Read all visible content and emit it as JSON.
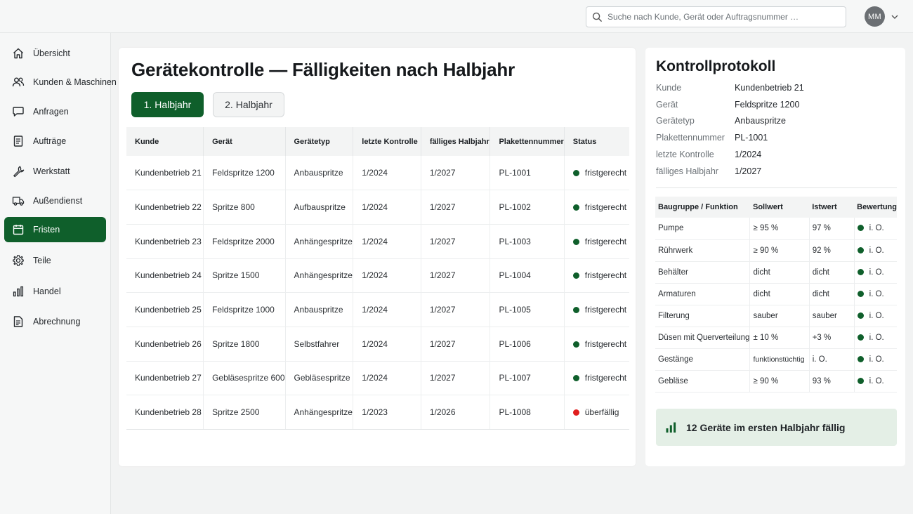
{
  "search": {
    "placeholder": "Suche nach Kunde, Gerät oder Auftragsnummer …",
    "icon": "search-icon"
  },
  "user": {
    "initials": "MM"
  },
  "sidebar": {
    "items": [
      {
        "label": "Übersicht",
        "icon": "home-icon"
      },
      {
        "label": "Kunden & Maschinen",
        "icon": "users-icon"
      },
      {
        "label": "Anfragen",
        "icon": "chat-icon"
      },
      {
        "label": "Aufträge",
        "icon": "document-icon"
      },
      {
        "label": "Werkstatt",
        "icon": "wrench-icon"
      },
      {
        "label": "Außendienst",
        "icon": "truck-icon"
      },
      {
        "label": "Fristen",
        "icon": "calendar-icon",
        "active": true
      },
      {
        "label": "Teile",
        "icon": "gear-icon"
      },
      {
        "label": "Handel",
        "icon": "bar-chart-icon"
      },
      {
        "label": "Abrechnung",
        "icon": "invoice-icon"
      }
    ]
  },
  "main": {
    "title": "Gerätekontrolle — Fälligkeiten nach Halbjahr",
    "tabs": [
      {
        "label": "1. Halbjahr",
        "active": true
      },
      {
        "label": "2. Halbjahr",
        "active": false
      }
    ],
    "columns": [
      "Kunde",
      "Gerät",
      "Gerätetyp",
      "letzte Kontrolle",
      "fälliges Halbjahr",
      "Plakettennummer",
      "Status"
    ],
    "rows": [
      [
        "Kundenbetrieb 21",
        "Feldspritze 1200",
        "Anbauspritze",
        "1/2024",
        "1/2027",
        "PL-1001",
        "fristgerecht"
      ],
      [
        "Kundenbetrieb 22",
        "Spritze 800",
        "Aufbauspritze",
        "1/2024",
        "1/2027",
        "PL-1002",
        "fristgerecht"
      ],
      [
        "Kundenbetrieb 23",
        "Feldspritze 2000",
        "Anhängespritze",
        "1/2024",
        "1/2027",
        "PL-1003",
        "fristgerecht"
      ],
      [
        "Kundenbetrieb 24",
        "Spritze 1500",
        "Anhängespritze",
        "1/2024",
        "1/2027",
        "PL-1004",
        "fristgerecht"
      ],
      [
        "Kundenbetrieb 25",
        "Feldspritze 1000",
        "Anbauspritze",
        "1/2024",
        "1/2027",
        "PL-1005",
        "fristgerecht"
      ],
      [
        "Kundenbetrieb 26",
        "Spritze 1800",
        "Selbstfahrer",
        "1/2024",
        "1/2027",
        "PL-1006",
        "fristgerecht"
      ],
      [
        "Kundenbetrieb 27",
        "Gebläsespritze 600",
        "Gebläsespritze",
        "1/2024",
        "1/2027",
        "PL-1007",
        "fristgerecht"
      ],
      [
        "Kundenbetrieb 28",
        "Spritze 2500",
        "Anhängespritze",
        "1/2023",
        "1/2026",
        "PL-1008",
        "überfällig"
      ]
    ]
  },
  "protocol": {
    "title": "Kontrollprotokoll",
    "fields": [
      {
        "key": "Kunde",
        "value": "Kundenbetrieb 21"
      },
      {
        "key": "Gerät",
        "value": "Feldspritze 1200"
      },
      {
        "key": "Gerätetyp",
        "value": "Anbauspritze"
      },
      {
        "key": "Plakettennummer",
        "value": "PL-1001"
      },
      {
        "key": "letzte Kontrolle",
        "value": "1/2024"
      },
      {
        "key": "fälliges Halbjahr",
        "value": "1/2027"
      }
    ],
    "columns": [
      "Baugruppe / Funktion",
      "Sollwert",
      "Istwert",
      "Bewertung"
    ],
    "rows": [
      [
        "Pumpe",
        "≥ 95 %",
        "97 %",
        "i. O."
      ],
      [
        "Rührwerk",
        "≥ 90 %",
        "92 %",
        "i. O."
      ],
      [
        "Behälter",
        "dicht",
        "dicht",
        "i. O."
      ],
      [
        "Armaturen",
        "dicht",
        "dicht",
        "i. O."
      ],
      [
        "Filterung",
        "sauber",
        "sauber",
        "i. O."
      ],
      [
        "Düsen mit Querverteilung",
        "± 10 %",
        "+3 %",
        "i. O."
      ],
      [
        "Gestänge",
        "funktionstüchtig",
        "i. O.",
        "i. O."
      ],
      [
        "Gebläse",
        "≥ 90 %",
        "93 %",
        "i. O."
      ]
    ],
    "summary": "12 Geräte im ersten Halbjahr fällig"
  },
  "colors": {
    "accent": "#0f5f2b",
    "status_ok": "#0f5f2b",
    "status_overdue": "#e01e1e",
    "summary_bg": "#e4efe6"
  }
}
